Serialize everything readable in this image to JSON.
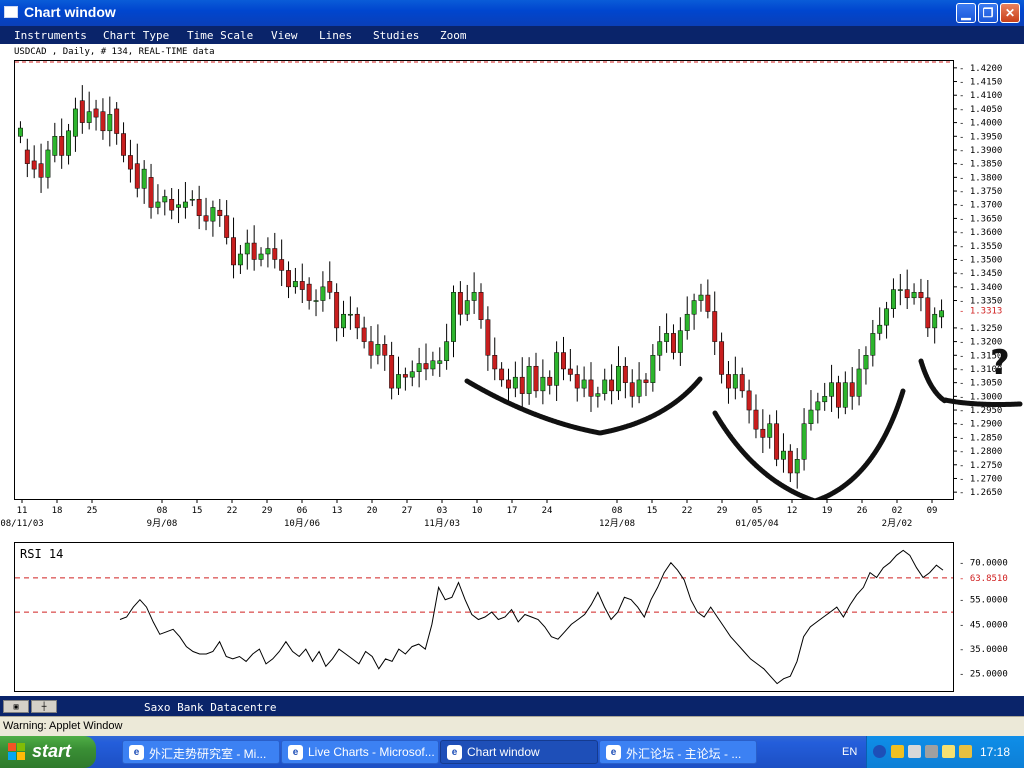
{
  "window": {
    "title": "Chart window"
  },
  "menu": [
    "Instruments",
    "Chart Type",
    "Time Scale",
    "View",
    "Lines",
    "Studies",
    "Zoom"
  ],
  "instrument_label": "USDCAD , Daily, # 134, REAL-TIME data",
  "rsi_label": "RSI 14",
  "status": {
    "provider": "Saxo Bank Datacentre",
    "warning": "Warning: Applet Window"
  },
  "taskbar": {
    "start_label": "start",
    "tasks": [
      "外汇走势研究室 - Mi...",
      "Live Charts - Microsof...",
      "Chart window",
      "外汇论坛 - 主论坛 - ..."
    ],
    "language": "EN",
    "clock": "17:18"
  },
  "annotation": {
    "question_mark": "?"
  },
  "colors": {
    "up_candle": "#2db52d",
    "down_candle": "#c81e1e",
    "window_bg": "#0a246a",
    "reference_line": "#d02020"
  },
  "chart_data": [
    {
      "type": "candlestick",
      "title": "USDCAD , Daily, # 134, REAL-TIME data",
      "y_ticks": [
        "1.4200",
        "1.4150",
        "1.4100",
        "1.4050",
        "1.4000",
        "1.3950",
        "1.3900",
        "1.3850",
        "1.3800",
        "1.3750",
        "1.3700",
        "1.3650",
        "1.3600",
        "1.3550",
        "1.3500",
        "1.3450",
        "1.3400",
        "1.3350",
        "1.3250",
        "1.3200",
        "1.3150",
        "1.3100",
        "1.3050",
        "1.3000",
        "1.2950",
        "1.2900",
        "1.2850",
        "1.2800",
        "1.2750",
        "1.2700",
        "1.2650"
      ],
      "ylim": [
        1.2625,
        1.4225
      ],
      "last_price_label": "1.3313",
      "last_price": 1.3313,
      "x_day_labels": [
        "11",
        "18",
        "25",
        "08",
        "15",
        "22",
        "29",
        "06",
        "13",
        "20",
        "27",
        "03",
        "10",
        "17",
        "24",
        "08",
        "15",
        "22",
        "29",
        "05",
        "12",
        "19",
        "26",
        "02",
        "09"
      ],
      "x_month_labels": [
        "08/11/03",
        "9月/08",
        "10月/06",
        "11月/03",
        "12月/08",
        "01/05/04",
        "2月/02"
      ],
      "close": [
        1.398,
        1.385,
        1.383,
        1.38,
        1.39,
        1.395,
        1.388,
        1.397,
        1.405,
        1.4,
        1.404,
        1.402,
        1.397,
        1.403,
        1.396,
        1.388,
        1.383,
        1.376,
        1.383,
        1.369,
        1.371,
        1.373,
        1.368,
        1.37,
        1.371,
        1.372,
        1.366,
        1.364,
        1.369,
        1.366,
        1.358,
        1.348,
        1.352,
        1.356,
        1.35,
        1.352,
        1.354,
        1.35,
        1.346,
        1.34,
        1.342,
        1.339,
        1.335,
        1.335,
        1.34,
        1.338,
        1.325,
        1.33,
        1.33,
        1.325,
        1.32,
        1.315,
        1.319,
        1.315,
        1.303,
        1.308,
        1.307,
        1.309,
        1.312,
        1.31,
        1.313,
        1.313,
        1.32,
        1.338,
        1.33,
        1.335,
        1.338,
        1.328,
        1.315,
        1.31,
        1.306,
        1.303,
        1.307,
        1.301,
        1.311,
        1.302,
        1.307,
        1.304,
        1.316,
        1.31,
        1.308,
        1.303,
        1.306,
        1.3,
        1.301,
        1.306,
        1.302,
        1.311,
        1.305,
        1.3,
        1.306,
        1.305,
        1.315,
        1.32,
        1.323,
        1.316,
        1.324,
        1.33,
        1.335,
        1.337,
        1.331,
        1.32,
        1.308,
        1.303,
        1.308,
        1.302,
        1.295,
        1.288,
        1.285,
        1.29,
        1.277,
        1.28,
        1.272,
        1.277,
        1.29,
        1.295,
        1.298,
        1.3,
        1.305,
        1.296,
        1.305,
        1.3,
        1.31,
        1.315,
        1.323,
        1.326,
        1.332,
        1.339,
        1.339,
        1.336,
        1.338,
        1.336,
        1.325,
        1.33,
        1.3313
      ],
      "open": [
        1.395,
        1.39,
        1.386,
        1.385,
        1.38,
        1.388,
        1.395,
        1.388,
        1.395,
        1.408,
        1.4,
        1.405,
        1.404,
        1.397,
        1.405,
        1.396,
        1.388,
        1.385,
        1.376,
        1.38,
        1.369,
        1.371,
        1.372,
        1.369,
        1.369,
        1.372,
        1.372,
        1.366,
        1.364,
        1.368,
        1.366,
        1.358,
        1.348,
        1.352,
        1.356,
        1.35,
        1.352,
        1.354,
        1.35,
        1.346,
        1.34,
        1.342,
        1.341,
        1.335,
        1.335,
        1.342,
        1.338,
        1.325,
        1.33,
        1.33,
        1.325,
        1.32,
        1.315,
        1.319,
        1.315,
        1.303,
        1.308,
        1.307,
        1.309,
        1.312,
        1.31,
        1.312,
        1.313,
        1.32,
        1.338,
        1.33,
        1.335,
        1.338,
        1.328,
        1.315,
        1.31,
        1.306,
        1.303,
        1.307,
        1.301,
        1.311,
        1.302,
        1.307,
        1.304,
        1.316,
        1.31,
        1.308,
        1.303,
        1.306,
        1.3,
        1.301,
        1.306,
        1.302,
        1.311,
        1.305,
        1.3,
        1.306,
        1.305,
        1.315,
        1.32,
        1.323,
        1.316,
        1.324,
        1.33,
        1.335,
        1.337,
        1.331,
        1.32,
        1.308,
        1.303,
        1.308,
        1.302,
        1.295,
        1.288,
        1.285,
        1.29,
        1.277,
        1.28,
        1.272,
        1.277,
        1.29,
        1.295,
        1.298,
        1.3,
        1.305,
        1.296,
        1.305,
        1.3,
        1.31,
        1.315,
        1.323,
        1.326,
        1.332,
        1.339,
        1.339,
        1.336,
        1.338,
        1.336,
        1.325,
        1.329
      ]
    },
    {
      "type": "line",
      "title": "RSI 14",
      "y_ticks": [
        "70.0000",
        "55.0000",
        "45.0000",
        "35.0000",
        "25.0000"
      ],
      "ylim": [
        18,
        78
      ],
      "reference_lines": [
        63.851,
        50
      ],
      "last_value_label": "63.8510",
      "values": [
        47,
        48,
        52,
        55,
        52,
        46,
        41,
        42,
        43,
        40,
        36,
        34,
        33,
        33,
        34,
        38,
        32,
        31,
        32,
        30,
        33,
        35,
        29,
        31,
        34,
        38,
        34,
        32,
        35,
        30,
        34,
        28,
        31,
        35,
        33,
        31,
        29,
        34,
        32,
        27,
        31,
        30,
        35,
        33,
        36,
        37,
        35,
        45,
        60,
        55,
        56,
        62,
        55,
        49,
        47,
        48,
        50,
        47,
        48,
        51,
        46,
        49,
        48,
        47,
        44,
        40,
        39,
        42,
        45,
        47,
        49,
        53,
        58,
        52,
        47,
        50,
        56,
        55,
        52,
        48,
        55,
        60,
        66,
        70,
        67,
        63,
        55,
        50,
        48,
        52,
        48,
        44,
        40,
        37,
        34,
        31,
        29,
        27,
        24,
        21,
        23,
        24,
        30,
        40,
        44,
        46,
        48,
        50,
        52,
        48,
        53,
        57,
        60,
        66,
        64,
        68,
        70,
        73,
        75,
        73,
        68,
        64,
        66,
        69,
        67
      ]
    }
  ]
}
